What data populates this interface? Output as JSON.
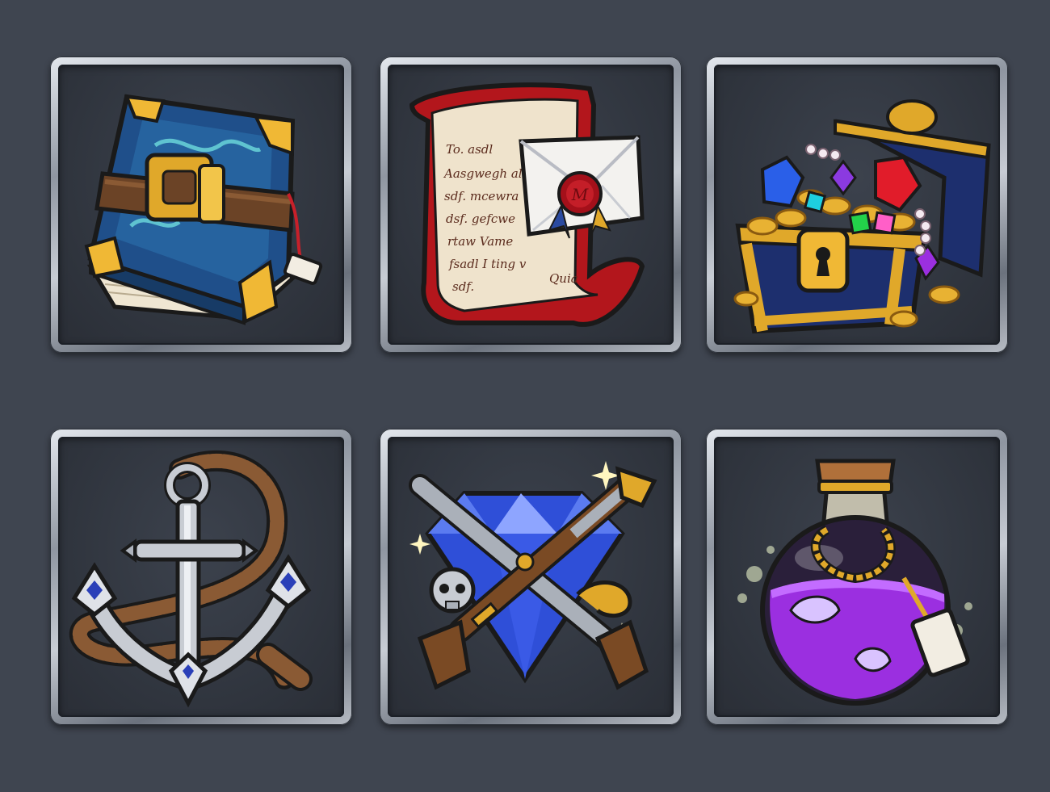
{
  "items": [
    {
      "name": "spellbook-icon"
    },
    {
      "name": "letter-scroll-icon",
      "letter_lines": [
        "To. asdl",
        "Aasgwegh all",
        "sdf. mcewra",
        "dsf. gefcwe",
        "rtaw Vame",
        "fsadl I ting v",
        "sdf."
      ],
      "signature": "Quia",
      "seal_letter": "M"
    },
    {
      "name": "treasure-chest-icon"
    },
    {
      "name": "anchor-icon"
    },
    {
      "name": "crossed-pistols-icon"
    },
    {
      "name": "potion-bottle-icon"
    }
  ],
  "colors": {
    "background": "#3f4550",
    "slot_inner": "#2f343d",
    "gold": "#e0a82a",
    "book_blue": "#1f4f8a",
    "scroll_red": "#b3161c",
    "potion_purple": "#9b2fe0",
    "diamond_blue": "#2f4fd8"
  }
}
